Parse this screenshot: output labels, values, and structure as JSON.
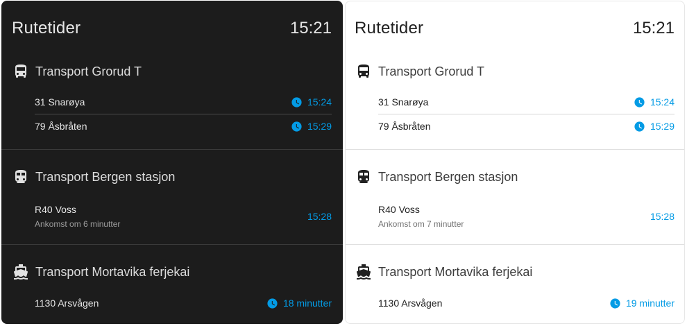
{
  "dark": {
    "title": "Rutetider",
    "clock": "15:21",
    "stops": [
      {
        "icon": "bus-icon",
        "name": "Transport Grorud T",
        "departures": [
          {
            "line": "31 Snarøya",
            "time": "15:24",
            "clock": true
          },
          {
            "line": "79 Åsbråten",
            "time": "15:29",
            "clock": true
          }
        ]
      },
      {
        "icon": "train-icon",
        "name": "Transport Bergen stasjon",
        "departures": [
          {
            "line": "R40 Voss",
            "sub": "Ankomst om 6 minutter",
            "time": "15:28",
            "clock": false
          }
        ]
      },
      {
        "icon": "ferry-icon",
        "name": "Transport Mortavika ferjekai",
        "departures": [
          {
            "line": "1130 Arsvågen",
            "time": "18 minutter",
            "clock": true
          }
        ]
      }
    ]
  },
  "light": {
    "title": "Rutetider",
    "clock": "15:21",
    "stops": [
      {
        "icon": "bus-icon",
        "name": "Transport Grorud T",
        "departures": [
          {
            "line": "31 Snarøya",
            "time": "15:24",
            "clock": true
          },
          {
            "line": "79 Åsbråten",
            "time": "15:29",
            "clock": true
          }
        ]
      },
      {
        "icon": "train-icon",
        "name": "Transport Bergen stasjon",
        "departures": [
          {
            "line": "R40 Voss",
            "sub": "Ankomst om 7 minutter",
            "time": "15:28",
            "clock": false
          }
        ]
      },
      {
        "icon": "ferry-icon",
        "name": "Transport Mortavika ferjekai",
        "departures": [
          {
            "line": "1130 Arsvågen",
            "time": "19 minutter",
            "clock": true
          }
        ]
      }
    ]
  },
  "colors": {
    "accent": "#039be5",
    "dark_bg": "#1c1c1c",
    "light_bg": "#ffffff"
  }
}
